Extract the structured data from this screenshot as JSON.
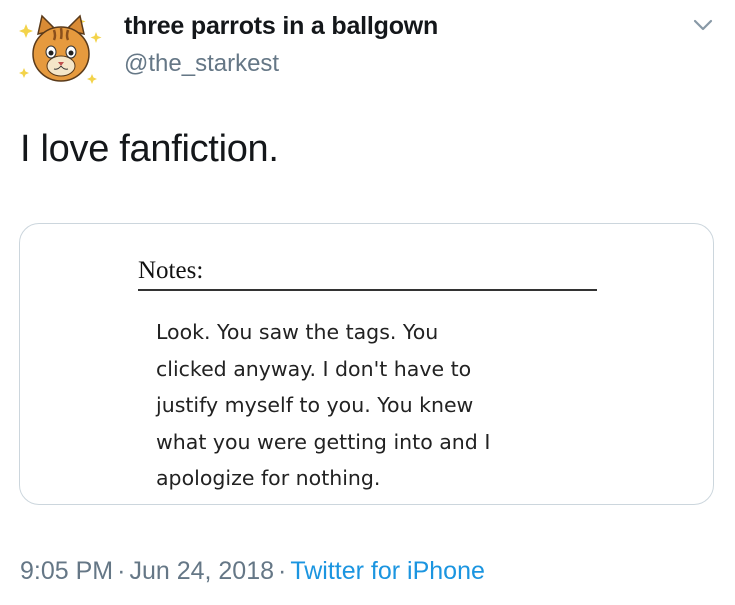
{
  "author": {
    "display_name": "three parrots in a ballgown",
    "handle": "@the_starkest"
  },
  "tweet": {
    "text": "I love fanfiction."
  },
  "media": {
    "heading": "Notes:",
    "lines": [
      "Look. You saw the tags. You",
      "clicked anyway. I don't have to",
      "justify myself to you. You knew",
      "what you were getting into and I",
      "apologize for nothing."
    ]
  },
  "footer": {
    "time": "9:05 PM",
    "separator": "·",
    "date": "Jun 24, 2018",
    "source": "Twitter for iPhone"
  },
  "colors": {
    "link": "#1b95e0",
    "secondary_text": "#657786",
    "border": "#ccd6dd"
  },
  "icons": {
    "avatar": "cat-face-avatar",
    "menu": "chevron-down-icon"
  }
}
